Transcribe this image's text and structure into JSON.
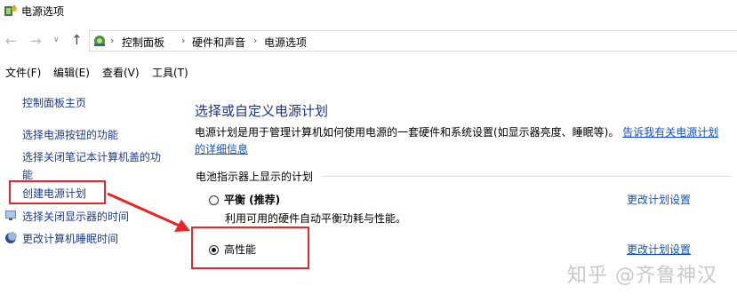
{
  "window": {
    "title": "电源选项"
  },
  "address_bar": {
    "breadcrumbs": [
      "控制面板",
      "硬件和声音",
      "电源选项"
    ]
  },
  "menu": {
    "items": [
      "文件(F)",
      "编辑(E)",
      "查看(V)",
      "工具(T)"
    ]
  },
  "left_pane": {
    "links": [
      "控制面板主页",
      "选择电源按钮的功能",
      "选择关闭笔记本计算机盖的功能",
      "创建电源计划",
      "选择关闭显示器的时间",
      "更改计算机睡眠时间"
    ]
  },
  "main": {
    "heading": "选择或自定义电源计划",
    "description": "电源计划是用于管理计算机如何使用电源的一套硬件和系统设置(如显示器亮度、睡眠等)。",
    "description_link": "告诉我有关电源计划的详细信息",
    "group_label": "电池指示器上显示的计划",
    "plans": [
      {
        "name": "平衡 (推荐)",
        "description": "利用可用的硬件自动平衡功耗与性能。",
        "selected": false,
        "change_link": "更改计划设置"
      },
      {
        "name": "高性能",
        "description": "",
        "selected": true,
        "change_link": "更改计划设置"
      }
    ]
  },
  "watermark": "知乎 @齐鲁神汉",
  "colors": {
    "annotation_red": "#e62727",
    "link_blue": "#0f52c4",
    "heading_blue": "#1e3287"
  }
}
